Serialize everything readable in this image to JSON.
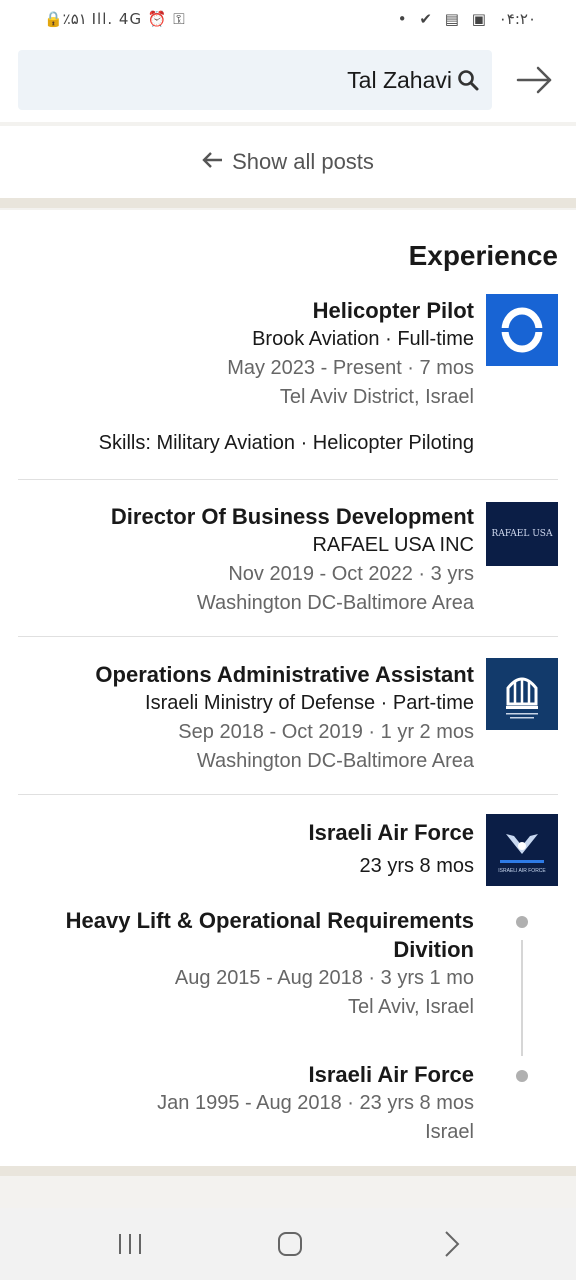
{
  "status_bar": {
    "left_text": "🔒٪۵۱ Ill. 4G ⏰ ⚿",
    "right_text": "۰۴:۲۰"
  },
  "search": {
    "query": "Tal Zahavi"
  },
  "show_all_posts": "Show all posts",
  "experience": {
    "title": "Experience",
    "items": [
      {
        "title": "Helicopter Pilot",
        "company": "Brook Aviation · Full-time",
        "dates": "May 2023 - Present · 7 mos",
        "location": "Tel Aviv District, Israel",
        "skills": "Skills: Military Aviation · Helicopter Piloting",
        "logo": "brook-aviation-logo"
      },
      {
        "title": "Director Of Business Development",
        "company": "RAFAEL USA INC",
        "dates": "Nov 2019 - Oct 2022 · 3 yrs",
        "location": "Washington DC-Baltimore Area",
        "logo": "rafael-usa-logo",
        "logo_text": "RAFAEL USA"
      },
      {
        "title": "Operations Administrative Assistant",
        "company": "Israeli Ministry of Defense · Part-time",
        "dates": "Sep 2018 - Oct 2019 · 1 yr 2 mos",
        "location": "Washington DC-Baltimore Area",
        "logo": "ministry-of-defense-logo"
      },
      {
        "title": "Israeli Air Force",
        "duration": "23 yrs 8 mos",
        "logo": "israeli-air-force-logo",
        "logo_text": "ISRAELI AIR FORCE",
        "roles": [
          {
            "title_line1": "Heavy Lift & Operational Requirements",
            "title_line2": "Divition",
            "dates": "Aug 2015 - Aug 2018 · 3 yrs 1 mo",
            "location": "Tel Aviv, Israel"
          },
          {
            "title": "Israeli Air Force",
            "dates": "Jan 1995 - Aug 2018 · 23 yrs 8 mos",
            "location": "Israel"
          }
        ]
      }
    ]
  },
  "colors": {
    "brand_blue": "#0a66c2",
    "dark_navy": "#0b1e46",
    "text_gray": "#666666"
  }
}
